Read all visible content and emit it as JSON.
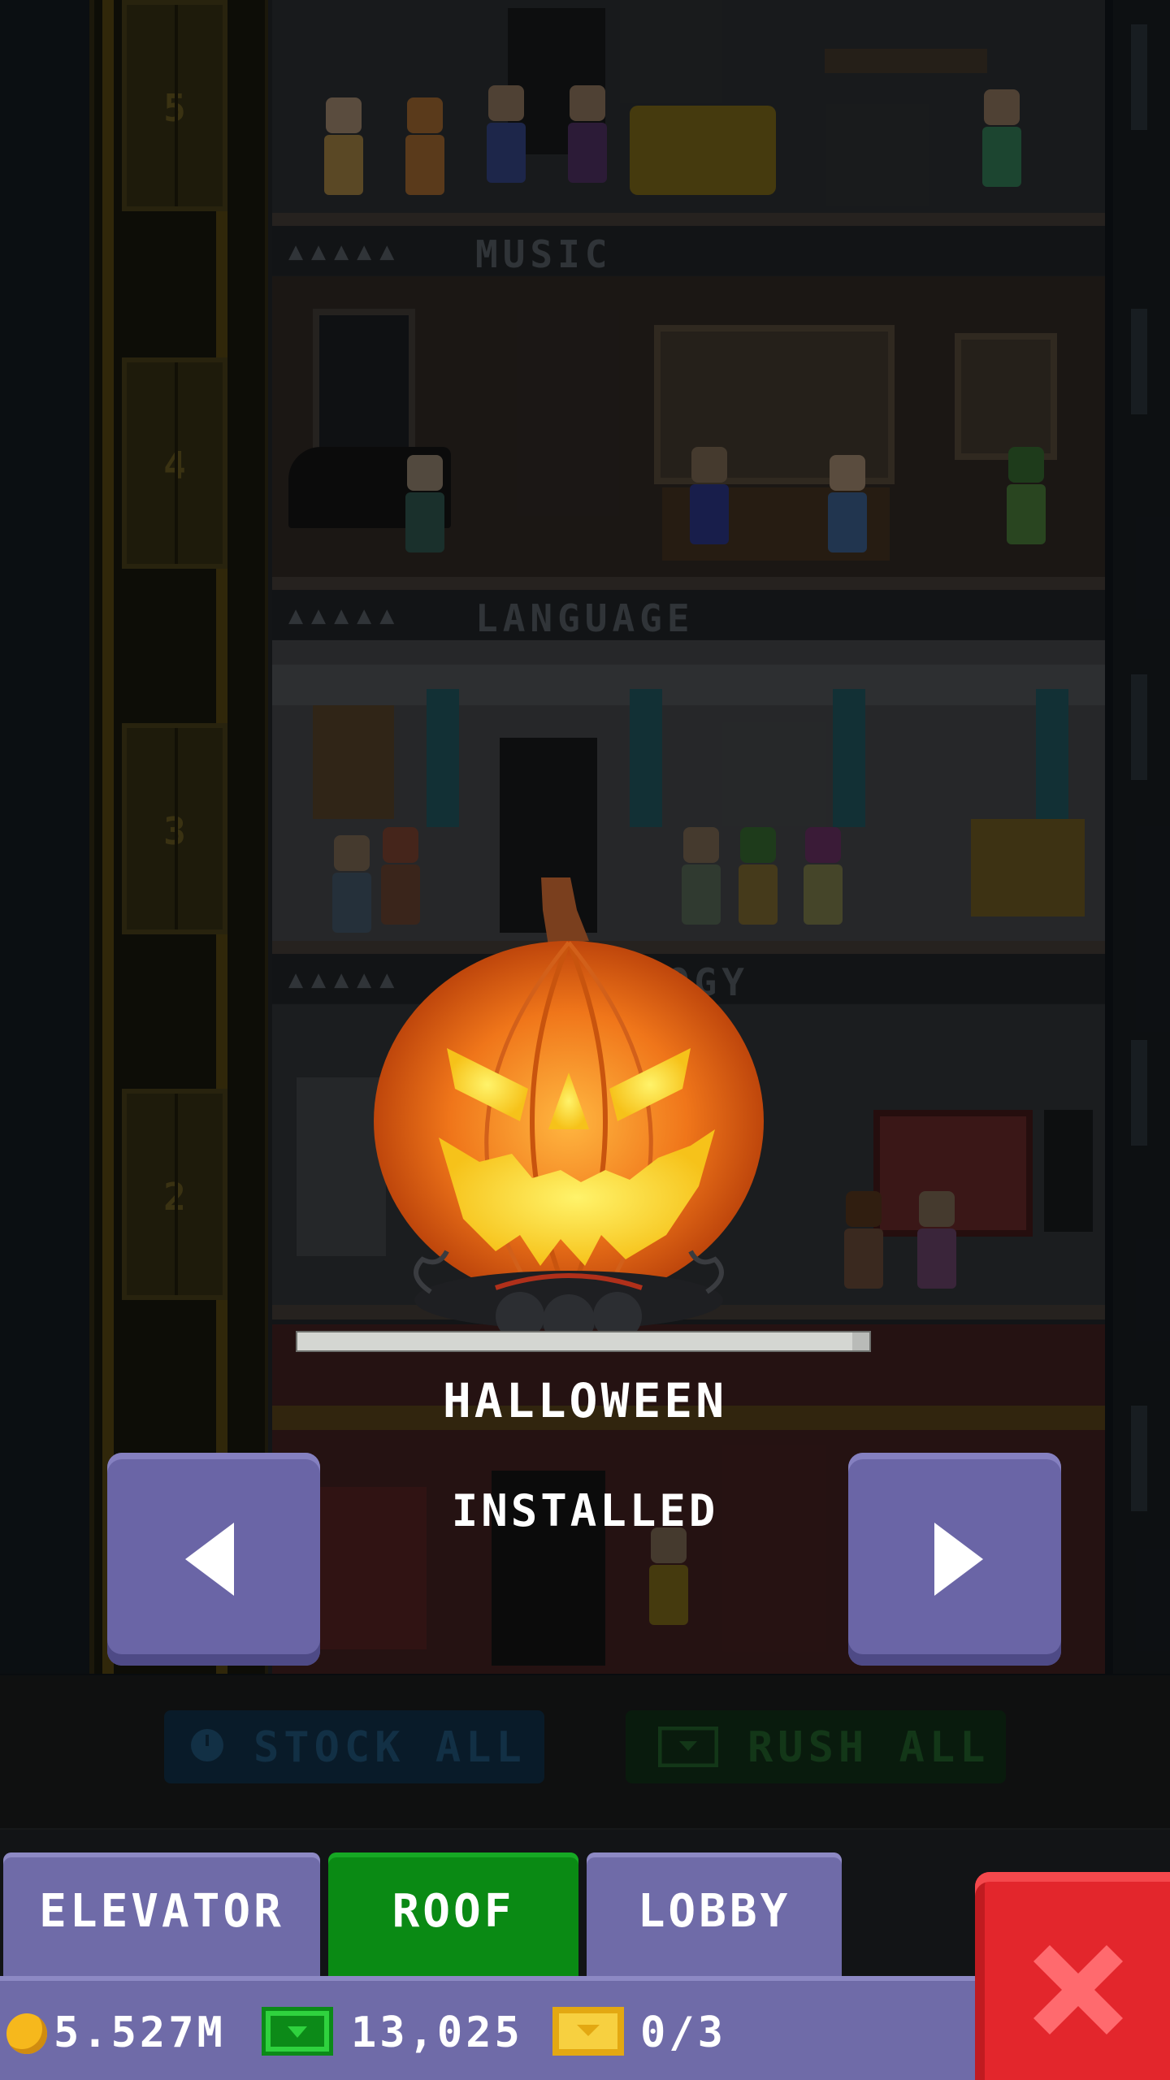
{
  "tower": {
    "floor_labels": [
      {
        "name": "MUSIC"
      },
      {
        "name": "LANGUAGE"
      },
      {
        "name": "TECHNOLOGY"
      }
    ],
    "elevator_numbers": [
      "5",
      "4",
      "3",
      "2"
    ],
    "stock_all_label": "STOCK ALL",
    "rush_all_label": "RUSH ALL"
  },
  "roof_picker": {
    "item_name": "HALLOWEEN",
    "status": "INSTALLED",
    "progress_fraction": 0.97,
    "prev_icon": "arrow-left-icon",
    "next_icon": "arrow-right-icon"
  },
  "tabs": [
    {
      "label": "ELEVATOR",
      "active": false
    },
    {
      "label": "ROOF",
      "active": true
    },
    {
      "label": "LOBBY",
      "active": false
    }
  ],
  "status": {
    "coins": "5.527M",
    "bux": "13,025",
    "tickets": "0/3",
    "coin_icon": "coin-icon",
    "bux_icon": "tower-bux-icon",
    "ticket_icon": "golden-ticket-icon"
  },
  "close_icon": "close-icon",
  "colors": {
    "tab_default": "#6f6ba8",
    "tab_active": "#0a8a14",
    "close": "#e3262c",
    "pumpkin": "#f07a10"
  }
}
